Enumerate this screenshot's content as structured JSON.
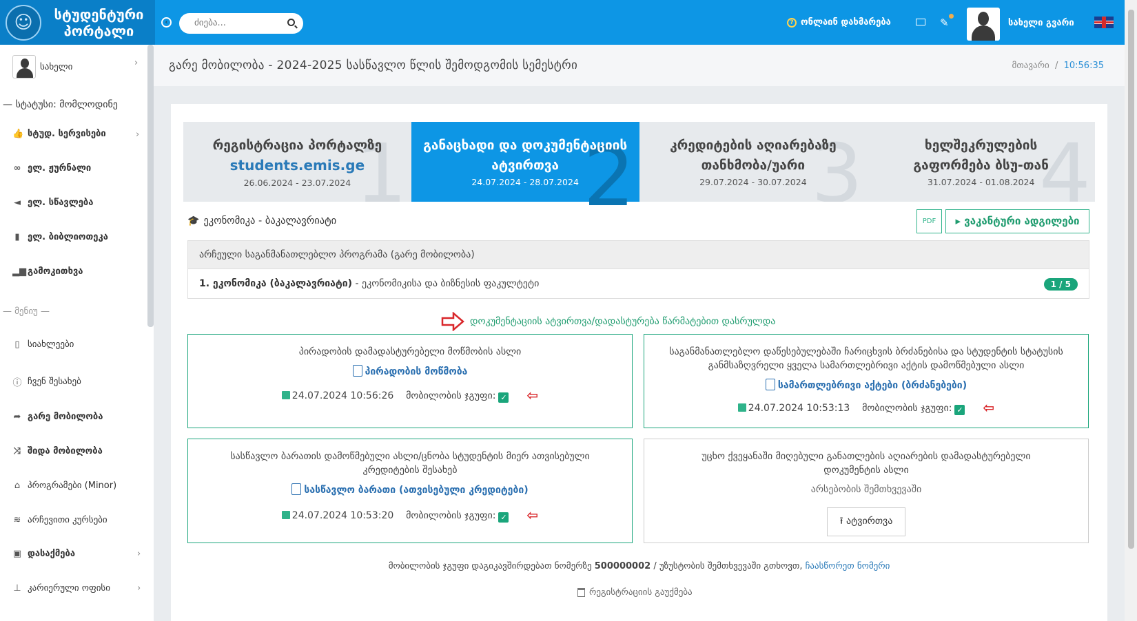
{
  "brand": {
    "title_line1": "სტუდენტური",
    "title_line2": "პორტალი"
  },
  "search": {
    "placeholder": "ძიება..."
  },
  "header": {
    "help_label": "ონლაინ დახმარება",
    "user_name": "სახელი გვარი"
  },
  "sidebar": {
    "user": "სახელი",
    "status": "— სტატუსი: მომლოდინე",
    "items_top": [
      {
        "icon": "thumbs-up-icon",
        "label": "სტუდ. სერვისები",
        "chevron": true
      },
      {
        "icon": "link-icon",
        "label": "ელ. ჟურნალი"
      },
      {
        "icon": "megaphone-icon",
        "label": "ელ. სწავლება"
      },
      {
        "icon": "book-icon",
        "label": "ელ. ბიბლიოთეკა"
      },
      {
        "icon": "bar-chart-icon",
        "label": "გამოკითხვა"
      }
    ],
    "menu_heading": "— მენიუ —",
    "items_menu": [
      {
        "icon": "clipboard-icon",
        "label": "სიახლეები"
      },
      {
        "icon": "info-icon",
        "label": "ჩვენ შესახებ"
      },
      {
        "icon": "share-icon",
        "label": "გარე მობილობა"
      },
      {
        "icon": "shuffle-icon",
        "label": "შიდა მობილობა"
      },
      {
        "icon": "graduation-cap-icon",
        "label": "პროგრამები (Minor)"
      },
      {
        "icon": "database-icon",
        "label": "არჩევითი კურსები"
      },
      {
        "icon": "briefcase-icon",
        "label": "დასაქმება",
        "chevron": true
      },
      {
        "icon": "office-icon",
        "label": "კარიერული ოფისი",
        "chevron": true
      }
    ]
  },
  "page": {
    "title": "გარე მობილობა - 2024-2025 სასწავლო წლის შემოდგომის სემესტრი",
    "breadcrumb_home": "მთავარი",
    "breadcrumb_sep": "/",
    "time": "10:56:35"
  },
  "steps": [
    {
      "title": "რეგისტრაცია პორტალზე",
      "link": "students.emis.ge",
      "date": "26.06.2024 - 23.07.2024",
      "number": "1",
      "active": false
    },
    {
      "title": "განაცხადი და დოკუმენტაციის ატვირთვა",
      "date": "24.07.2024 - 28.07.2024",
      "number": "2",
      "active": true
    },
    {
      "title": "კრედიტების აღიარებაზე თანხმობა/უარი",
      "date": "29.07.2024 - 30.07.2024",
      "number": "3",
      "active": false
    },
    {
      "title": "ხელშეკრულების გაფორმება ბსუ-თან",
      "date": "31.07.2024 - 01.08.2024",
      "number": "4",
      "active": false
    }
  ],
  "program": {
    "label": "ეკონომიკა - ბაკალავრიატი",
    "pdf_label": "PDF",
    "vacancies_button": "ვაკანტური ადგილები",
    "table_header": "არჩეული საგანმანათლებლო პროგრამა (გარე მობილობა)",
    "row_name": "1. ეკონომიკა (ბაკალავრიატი)",
    "row_faculty": " - ეკონომიკისა და ბიზნესის ფაკულტეტი",
    "row_badge": "1 / 5"
  },
  "success_message": "დოკუმენტაციის ატვირთვა/დადასტურება წარმატებით დასრულდა",
  "documents": [
    {
      "desc": "პირადობის დამადასტურებელი მოწმობის ასლი",
      "file": "პირადობის მოწმობა",
      "datetime": "24.07.2024 10:56:26",
      "group_label": "მობილობის ჯგუფი:"
    },
    {
      "desc": "საგანმანათლებლო დაწესებულებაში ჩარიცხვის ბრძანებისა და სტუდენტის სტატუსის განმსაზღვრელი ყველა სამართლებრივი აქტის დამოწმებული ასლი",
      "file": "სამართლებრივი აქტები (ბრძანებები)",
      "datetime": "24.07.2024 10:53:13",
      "group_label": "მობილობის ჯგუფი:"
    },
    {
      "desc": "სასწავლო ბარათის დამოწმებული ასლი/ცნობა სტუდენტის მიერ ათვისებული კრედიტების შესახებ",
      "file": "სასწავლო ბარათი (ათვისებული კრედიტები)",
      "datetime": "24.07.2024 10:53:20",
      "group_label": "მობილობის ჯგუფი:"
    },
    {
      "desc": "უცხო ქვეყანაში მიღებული განათლების აღიარების დამადასტურებელი დოკუმენტის ასლი",
      "note": "არსებობის შემთხვევაში",
      "upload": "ატვირთვა"
    }
  ],
  "footer": {
    "note_prefix": "მობილობის ჯგუფი დაგიკავშირდებათ ნომერზე ",
    "phone": "500000002",
    "note_suffix": " / უზუსტობის შემთხვევაში გთხოვთ, ",
    "link": "ჩაასწორეთ ნომერი",
    "cancel": "რეგისტრაციის გაუქმება"
  },
  "colors": {
    "primary": "#0d96e5",
    "accent_green": "#1aa57b",
    "arrow_red": "#d9262a"
  }
}
